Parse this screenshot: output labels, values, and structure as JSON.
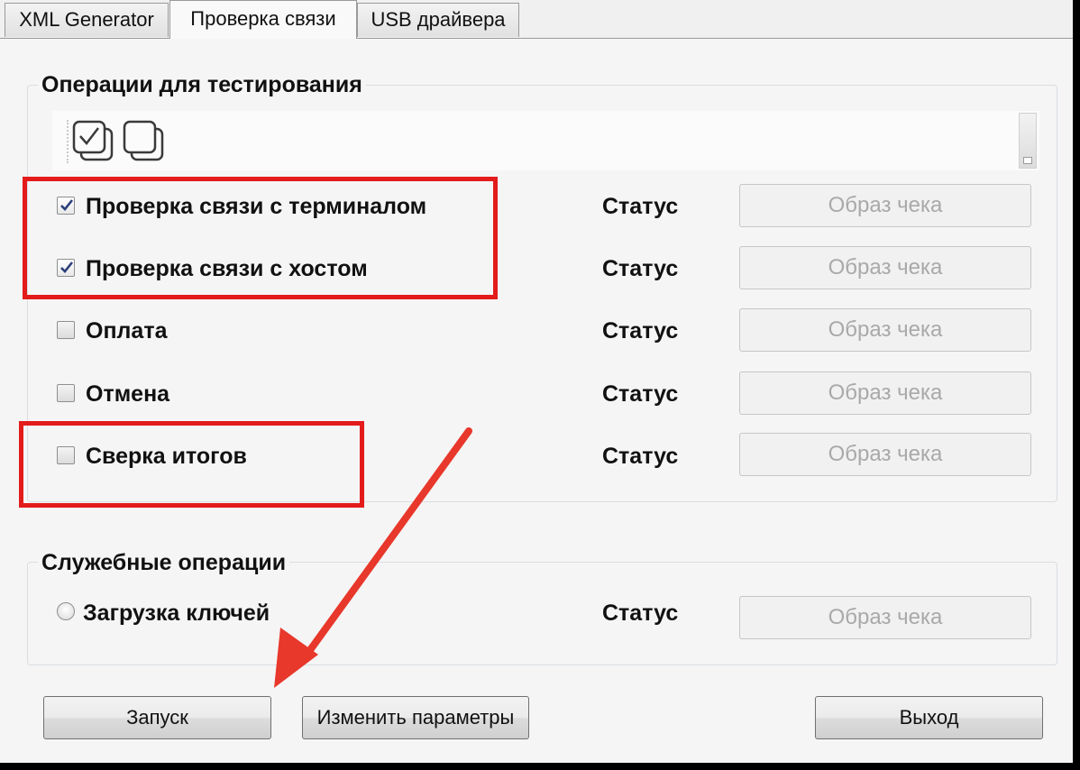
{
  "tabs": [
    {
      "label": "XML Generator",
      "active": false
    },
    {
      "label": "Проверка связи",
      "active": true
    },
    {
      "label": "USB драйвера",
      "active": false
    }
  ],
  "test_group": {
    "title": "Операции для тестирования",
    "toolbar_icons": [
      "select-all-icon",
      "deselect-all-icon"
    ],
    "operations": [
      {
        "label": "Проверка связи с терминалом",
        "checked": true,
        "status": "Статус",
        "receipt": "Образ чека"
      },
      {
        "label": "Проверка связи с хостом",
        "checked": true,
        "status": "Статус",
        "receipt": "Образ чека"
      },
      {
        "label": "Оплата",
        "checked": false,
        "status": "Статус",
        "receipt": "Образ чека"
      },
      {
        "label": "Отмена",
        "checked": false,
        "status": "Статус",
        "receipt": "Образ чека"
      },
      {
        "label": "Сверка итогов",
        "checked": false,
        "status": "Статус",
        "receipt": "Образ чека"
      }
    ]
  },
  "service_group": {
    "title": "Служебные операции",
    "operations": [
      {
        "label": "Загрузка ключей",
        "selected": false,
        "status": "Статус",
        "receipt": "Образ чека"
      }
    ]
  },
  "buttons": {
    "start": "Запуск",
    "change_params": "Изменить параметры",
    "exit": "Выход"
  },
  "annotation_colors": {
    "highlight": "#e31b1b",
    "arrow": "#e8372b"
  }
}
